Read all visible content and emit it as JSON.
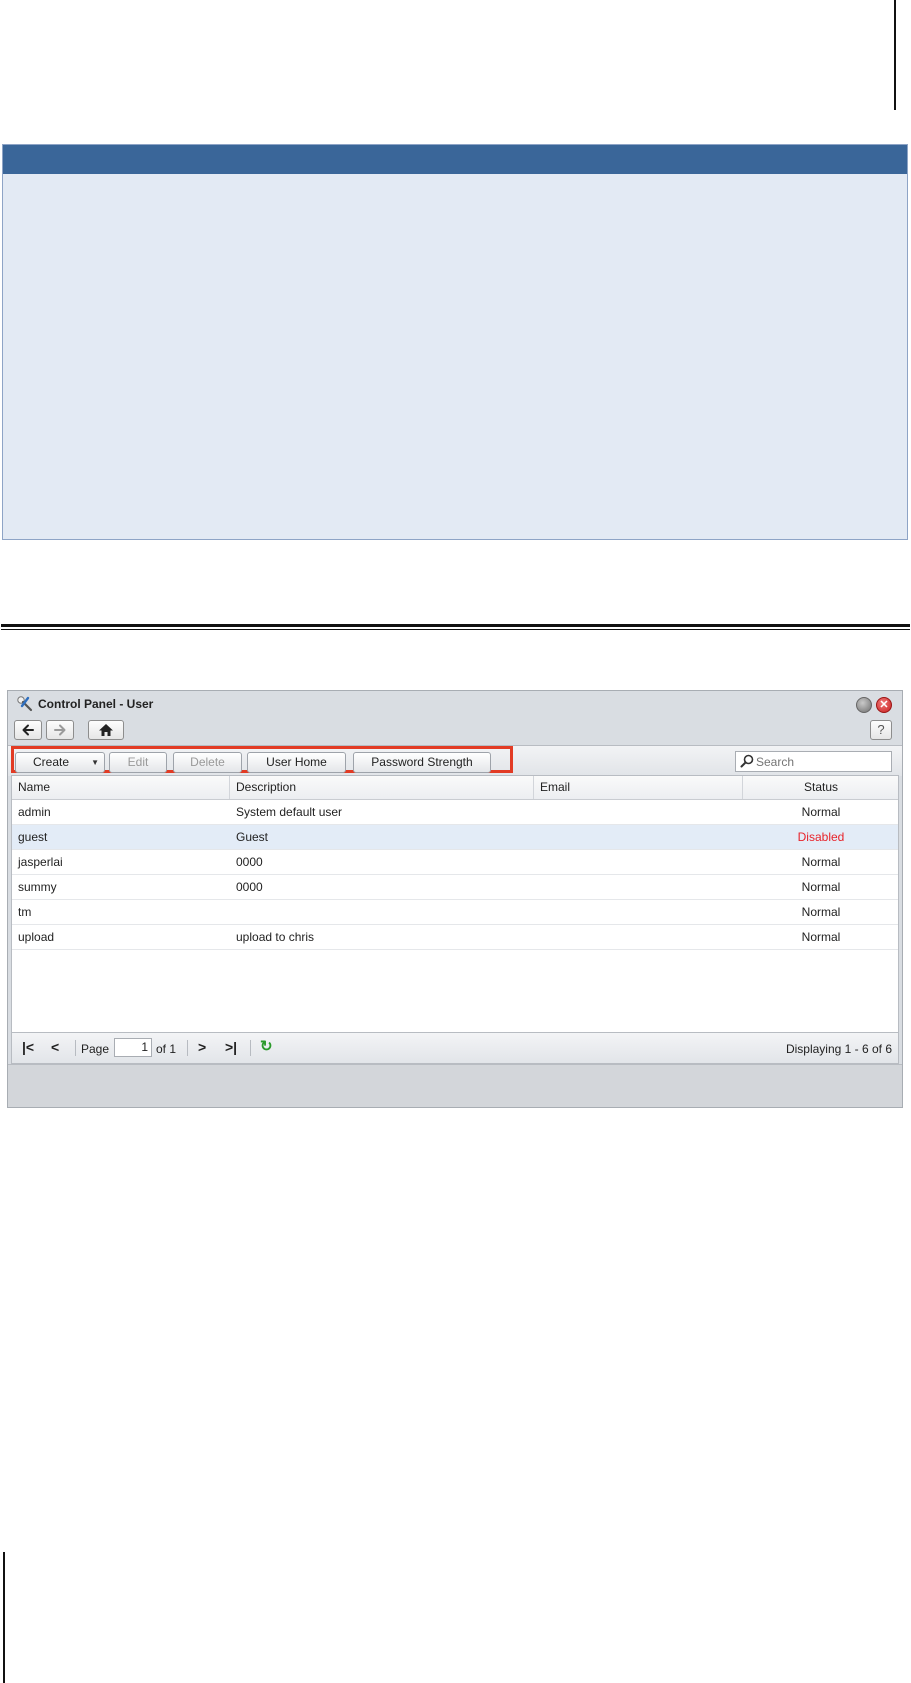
{
  "window": {
    "title": "Control Panel - User",
    "close_glyph": "✕"
  },
  "nav": {
    "back_icon": "arrow-left-icon",
    "forward_icon": "arrow-right-icon",
    "home_icon": "home-icon",
    "help_label": "?"
  },
  "toolbar": {
    "create_label": "Create",
    "edit_label": "Edit",
    "delete_label": "Delete",
    "user_home_label": "User Home",
    "password_strength_label": "Password Strength",
    "highlight_color": "#e23b24"
  },
  "search": {
    "placeholder": "Search",
    "value": ""
  },
  "grid": {
    "columns": [
      "Name",
      "Description",
      "Email",
      "Status"
    ],
    "rows": [
      {
        "name": "admin",
        "description": "System default user",
        "email": "",
        "status": "Normal"
      },
      {
        "name": "guest",
        "description": "Guest",
        "email": "",
        "status": "Disabled"
      },
      {
        "name": "jasperlai",
        "description": "0000",
        "email": "",
        "status": "Normal"
      },
      {
        "name": "summy",
        "description": "0000",
        "email": "",
        "status": "Normal"
      },
      {
        "name": "tm",
        "description": "",
        "email": "",
        "status": "Normal"
      },
      {
        "name": "upload",
        "description": "upload to chris",
        "email": "",
        "status": "Normal"
      }
    ],
    "selected_row": 1,
    "disabled_color": "#e8232a"
  },
  "pager": {
    "page_label": "Page",
    "page_value": "1",
    "of_label": "of 1",
    "display_text": "Displaying 1 - 6 of 6"
  },
  "colors": {
    "info_bar": "#3a6699",
    "info_fill": "#e3eaf4"
  }
}
